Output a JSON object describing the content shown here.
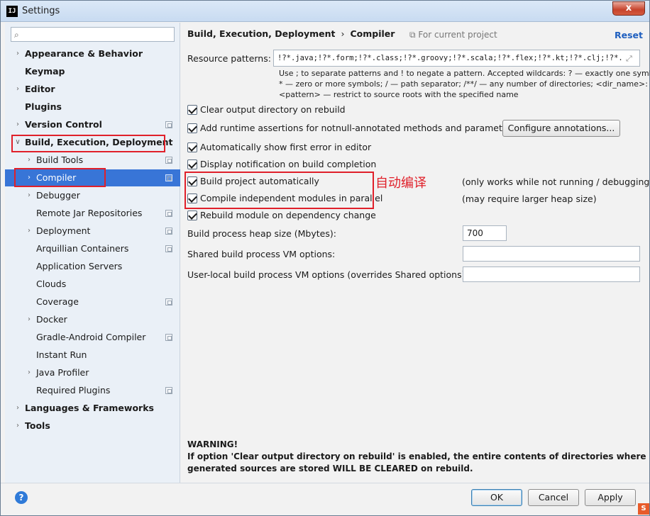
{
  "window": {
    "title": "Settings",
    "close_label": "x",
    "app_icon": "IJ"
  },
  "sidebar": {
    "search": {
      "placeholder": "",
      "value": ""
    },
    "items": [
      {
        "label": "Appearance & Behavior",
        "bold": true,
        "expandable": true,
        "level": 0
      },
      {
        "label": "Keymap",
        "bold": true,
        "expandable": false,
        "level": 0
      },
      {
        "label": "Editor",
        "bold": true,
        "expandable": true,
        "level": 0
      },
      {
        "label": "Plugins",
        "bold": true,
        "expandable": false,
        "level": 0
      },
      {
        "label": "Version Control",
        "bold": true,
        "expandable": true,
        "level": 0,
        "project_icon": true
      },
      {
        "label": "Build, Execution, Deployment",
        "bold": true,
        "expandable": true,
        "expanded": true,
        "level": 0
      },
      {
        "label": "Build Tools",
        "expandable": true,
        "level": 1,
        "project_icon": true
      },
      {
        "label": "Compiler",
        "expandable": true,
        "level": 1,
        "project_icon": true,
        "selected": true
      },
      {
        "label": "Debugger",
        "expandable": true,
        "level": 1
      },
      {
        "label": "Remote Jar Repositories",
        "expandable": false,
        "level": 1,
        "project_icon": true
      },
      {
        "label": "Deployment",
        "expandable": true,
        "level": 1,
        "project_icon": true
      },
      {
        "label": "Arquillian Containers",
        "expandable": false,
        "level": 1,
        "project_icon": true
      },
      {
        "label": "Application Servers",
        "expandable": false,
        "level": 1
      },
      {
        "label": "Clouds",
        "expandable": false,
        "level": 1
      },
      {
        "label": "Coverage",
        "expandable": false,
        "level": 1,
        "project_icon": true
      },
      {
        "label": "Docker",
        "expandable": true,
        "level": 1
      },
      {
        "label": "Gradle-Android Compiler",
        "expandable": false,
        "level": 1,
        "project_icon": true
      },
      {
        "label": "Instant Run",
        "expandable": false,
        "level": 1
      },
      {
        "label": "Java Profiler",
        "expandable": true,
        "level": 1
      },
      {
        "label": "Required Plugins",
        "expandable": false,
        "level": 1,
        "project_icon": true
      },
      {
        "label": "Languages & Frameworks",
        "bold": true,
        "expandable": true,
        "level": 0
      },
      {
        "label": "Tools",
        "bold": true,
        "expandable": true,
        "level": 0
      }
    ]
  },
  "main": {
    "breadcrumb": {
      "section": "Build, Execution, Deployment",
      "separator": "›",
      "page": "Compiler"
    },
    "for_current_project": "For current project",
    "reset_label": "Reset",
    "resource_patterns": {
      "label": "Resource patterns:",
      "value": "!?*.java;!?*.form;!?*.class;!?*.groovy;!?*.scala;!?*.flex;!?*.kt;!?*.clj;!?*.aj"
    },
    "hint_lines": [
      "Use ; to separate patterns and ! to negate a pattern. Accepted wildcards: ? — exactly one symbol;",
      "* — zero or more symbols; / — path separator; /**/ — any number of directories; <dir_name>:",
      "<pattern> — restrict to source roots with the specified name"
    ],
    "checkboxes": [
      {
        "label": "Clear output directory on rebuild",
        "checked": true
      },
      {
        "label": "Add runtime assertions for notnull-annotated methods and parameters",
        "checked": true
      },
      {
        "label": "Automatically show first error in editor",
        "checked": true
      },
      {
        "label": "Display notification on build completion",
        "checked": true
      },
      {
        "label": "Build project automatically",
        "checked": true,
        "note": "(only works while not running / debugging)"
      },
      {
        "label": "Compile independent modules in parallel",
        "checked": true,
        "note": "(may require larger heap size)"
      },
      {
        "label": "Rebuild module on dependency change",
        "checked": true
      }
    ],
    "configure_annotations_label": "Configure annotations...",
    "annotation_cn": "自动编译",
    "heap_size": {
      "label": "Build process heap size (Mbytes):",
      "value": "700"
    },
    "shared_vm": {
      "label": "Shared build process VM options:",
      "value": ""
    },
    "user_local_vm": {
      "label": "User-local build process VM options (overrides Shared options):",
      "value": ""
    },
    "warning": {
      "title": "WARNING!",
      "line1": "If option 'Clear output directory on rebuild' is enabled, the entire contents of directories where",
      "line2": "generated sources are stored WILL BE CLEARED on rebuild."
    }
  },
  "footer": {
    "help_label": "?",
    "ok_label": "OK",
    "cancel_label": "Cancel",
    "apply_label": "Apply"
  },
  "colors": {
    "selection": "#3875d7",
    "annotation_red": "#e0202a",
    "link": "#1f5fbf"
  }
}
